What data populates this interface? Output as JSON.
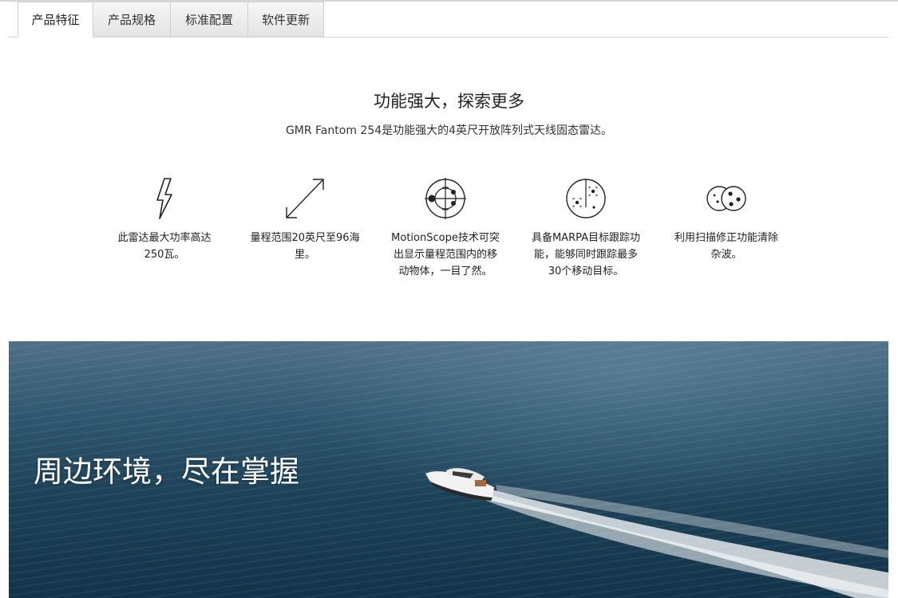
{
  "tabs": [
    {
      "label": "产品特征",
      "active": true
    },
    {
      "label": "产品规格",
      "active": false
    },
    {
      "label": "标准配置",
      "active": false
    },
    {
      "label": "软件更新",
      "active": false
    }
  ],
  "intro": {
    "headline": "功能强大，探索更多",
    "subline": "GMR Fantom 254是功能强大的4英尺开放阵列式天线固态雷达。"
  },
  "features": [
    {
      "icon": "lightning-bolt-icon",
      "text": "此雷达最大功率高达250瓦。"
    },
    {
      "icon": "diagonal-arrow-icon",
      "text": "量程范围20英尺至96海里。"
    },
    {
      "icon": "crosshair-target-icon",
      "text": "MotionScope技术可突出显示量程范围内的移动物体，一目了然。"
    },
    {
      "icon": "radar-tracking-icon",
      "text": "具备MARPA目标跟踪功能，能够同时跟踪最多30个移动目标。"
    },
    {
      "icon": "clutter-circles-icon",
      "text": "利用扫描修正功能清除杂波。"
    }
  ],
  "hero": {
    "title": "周边环境，尽在掌握"
  },
  "colors": {
    "tab_border": "#cfcfcf",
    "text": "#222222",
    "sea_dark": "#123349",
    "sea_light": "#4f7088"
  }
}
